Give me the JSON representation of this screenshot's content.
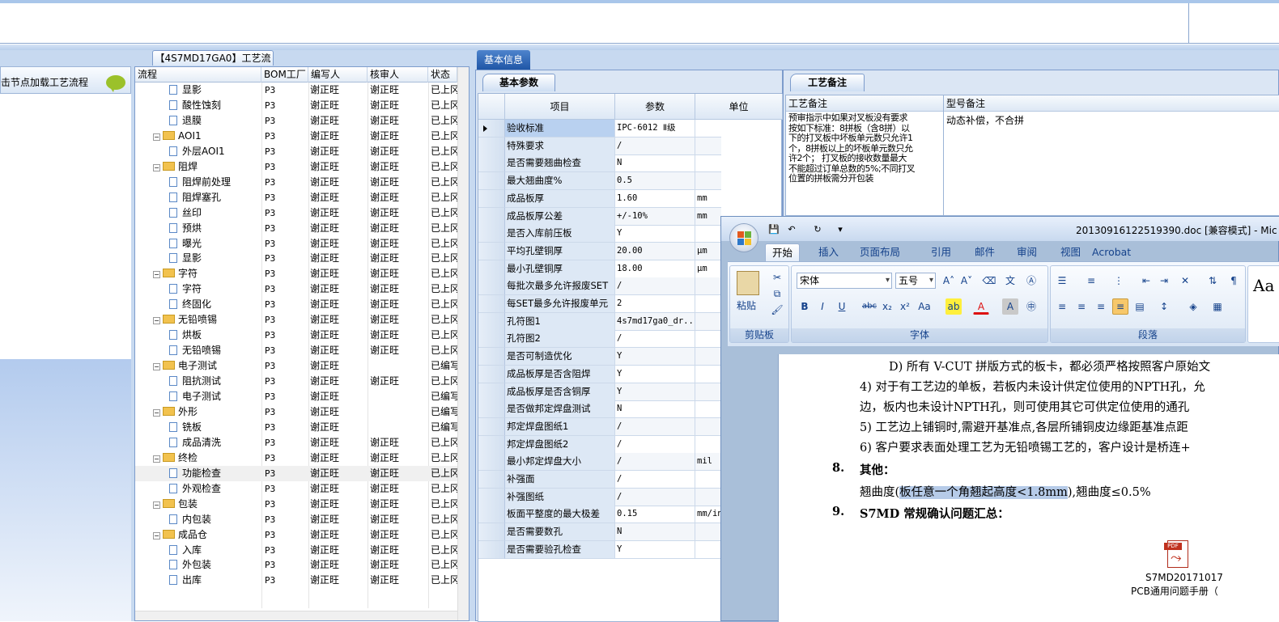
{
  "left_panel": {
    "hint": "击节点加载工艺流程"
  },
  "tree": {
    "tab_title": "【4S7MD17GA0】工艺流程",
    "columns": [
      "流程",
      "BOM工厂",
      "编写人",
      "核审人",
      "状态"
    ],
    "rows": [
      {
        "name": "显影",
        "kind": "doc",
        "bom": "P3",
        "writer": "谢正旺",
        "reviewer": "谢正旺",
        "status": "已上冈"
      },
      {
        "name": "酸性蚀刻",
        "kind": "doc",
        "bom": "P3",
        "writer": "谢正旺",
        "reviewer": "谢正旺",
        "status": "已上冈"
      },
      {
        "name": "退膜",
        "kind": "doc",
        "bom": "P3",
        "writer": "谢正旺",
        "reviewer": "谢正旺",
        "status": "已上冈"
      },
      {
        "name": "AOI1",
        "kind": "folder",
        "bom": "P3",
        "writer": "谢正旺",
        "reviewer": "谢正旺",
        "status": "已上冈"
      },
      {
        "name": "外层AOI1",
        "kind": "doc",
        "bom": "P3",
        "writer": "谢正旺",
        "reviewer": "谢正旺",
        "status": "已上冈"
      },
      {
        "name": "阻焊",
        "kind": "folder",
        "bom": "P3",
        "writer": "谢正旺",
        "reviewer": "谢正旺",
        "status": "已上冈"
      },
      {
        "name": "阻焊前处理",
        "kind": "doc",
        "bom": "P3",
        "writer": "谢正旺",
        "reviewer": "谢正旺",
        "status": "已上冈"
      },
      {
        "name": "阻焊塞孔",
        "kind": "doc",
        "bom": "P3",
        "writer": "谢正旺",
        "reviewer": "谢正旺",
        "status": "已上冈"
      },
      {
        "name": "丝印",
        "kind": "doc",
        "bom": "P3",
        "writer": "谢正旺",
        "reviewer": "谢正旺",
        "status": "已上冈"
      },
      {
        "name": "预烘",
        "kind": "doc",
        "bom": "P3",
        "writer": "谢正旺",
        "reviewer": "谢正旺",
        "status": "已上冈"
      },
      {
        "name": "曝光",
        "kind": "doc",
        "bom": "P3",
        "writer": "谢正旺",
        "reviewer": "谢正旺",
        "status": "已上冈"
      },
      {
        "name": "显影",
        "kind": "doc",
        "bom": "P3",
        "writer": "谢正旺",
        "reviewer": "谢正旺",
        "status": "已上冈"
      },
      {
        "name": "字符",
        "kind": "folder",
        "bom": "P3",
        "writer": "谢正旺",
        "reviewer": "谢正旺",
        "status": "已上冈"
      },
      {
        "name": "字符",
        "kind": "doc",
        "bom": "P3",
        "writer": "谢正旺",
        "reviewer": "谢正旺",
        "status": "已上冈"
      },
      {
        "name": "终固化",
        "kind": "doc",
        "bom": "P3",
        "writer": "谢正旺",
        "reviewer": "谢正旺",
        "status": "已上冈"
      },
      {
        "name": "无铅喷锡",
        "kind": "folder",
        "bom": "P3",
        "writer": "谢正旺",
        "reviewer": "谢正旺",
        "status": "已上冈"
      },
      {
        "name": "烘板",
        "kind": "doc",
        "bom": "P3",
        "writer": "谢正旺",
        "reviewer": "谢正旺",
        "status": "已上冈"
      },
      {
        "name": "无铅喷锡",
        "kind": "doc",
        "bom": "P3",
        "writer": "谢正旺",
        "reviewer": "谢正旺",
        "status": "已上冈"
      },
      {
        "name": "电子测试",
        "kind": "folder",
        "bom": "P3",
        "writer": "谢正旺",
        "reviewer": "",
        "status": "已编写"
      },
      {
        "name": "阻抗测试",
        "kind": "doc",
        "bom": "P3",
        "writer": "谢正旺",
        "reviewer": "谢正旺",
        "status": "已上冈"
      },
      {
        "name": "电子测试",
        "kind": "doc",
        "bom": "P3",
        "writer": "谢正旺",
        "reviewer": "",
        "status": "已编写"
      },
      {
        "name": "外形",
        "kind": "folder",
        "bom": "P3",
        "writer": "谢正旺",
        "reviewer": "",
        "status": "已编写"
      },
      {
        "name": "铣板",
        "kind": "doc",
        "bom": "P3",
        "writer": "谢正旺",
        "reviewer": "",
        "status": "已编写"
      },
      {
        "name": "成品清洗",
        "kind": "doc",
        "bom": "P3",
        "writer": "谢正旺",
        "reviewer": "谢正旺",
        "status": "已上冈"
      },
      {
        "name": "终检",
        "kind": "folder",
        "bom": "P3",
        "writer": "谢正旺",
        "reviewer": "谢正旺",
        "status": "已上冈"
      },
      {
        "name": "功能检查",
        "kind": "doc",
        "bom": "P3",
        "writer": "谢正旺",
        "reviewer": "谢正旺",
        "status": "已上冈",
        "selected": true
      },
      {
        "name": "外观检查",
        "kind": "doc",
        "bom": "P3",
        "writer": "谢正旺",
        "reviewer": "谢正旺",
        "status": "已上冈"
      },
      {
        "name": "包装",
        "kind": "folder",
        "bom": "P3",
        "writer": "谢正旺",
        "reviewer": "谢正旺",
        "status": "已上冈"
      },
      {
        "name": "内包装",
        "kind": "doc",
        "bom": "P3",
        "writer": "谢正旺",
        "reviewer": "谢正旺",
        "status": "已上冈"
      },
      {
        "name": "成品仓",
        "kind": "folder",
        "bom": "P3",
        "writer": "谢正旺",
        "reviewer": "谢正旺",
        "status": "已上冈"
      },
      {
        "name": "入库",
        "kind": "doc",
        "bom": "P3",
        "writer": "谢正旺",
        "reviewer": "谢正旺",
        "status": "已上冈"
      },
      {
        "name": "外包装",
        "kind": "doc",
        "bom": "P3",
        "writer": "谢正旺",
        "reviewer": "谢正旺",
        "status": "已上冈"
      },
      {
        "name": "出库",
        "kind": "doc",
        "bom": "P3",
        "writer": "谢正旺",
        "reviewer": "谢正旺",
        "status": "已上冈"
      }
    ]
  },
  "basic_info": {
    "tab": "基本信息",
    "subtab": "基本参数",
    "columns": [
      "项目",
      "参数",
      "单位"
    ],
    "rows": [
      {
        "item": "验收标准",
        "value": "IPC-6012 Ⅱ级",
        "unit": ""
      },
      {
        "item": "特殊要求",
        "value": "/",
        "unit": ""
      },
      {
        "item": "是否需要翘曲检查",
        "value": "N",
        "unit": ""
      },
      {
        "item": "最大翘曲度%",
        "value": "0.5",
        "unit": ""
      },
      {
        "item": "成品板厚",
        "value": "1.60",
        "unit": "mm"
      },
      {
        "item": "成品板厚公差",
        "value": "+/-10%",
        "unit": "mm"
      },
      {
        "item": "是否入库前压板",
        "value": "Y",
        "unit": ""
      },
      {
        "item": "平均孔壁铜厚",
        "value": "20.00",
        "unit": "μm"
      },
      {
        "item": "最小孔壁铜厚",
        "value": "18.00",
        "unit": "μm"
      },
      {
        "item": "每批次最多允许报废SET",
        "value": "/",
        "unit": ""
      },
      {
        "item": "每SET最多允许报废单元",
        "value": "2",
        "unit": ""
      },
      {
        "item": "孔符图1",
        "value": "4s7md17ga0_dr...",
        "unit": ""
      },
      {
        "item": "孔符图2",
        "value": "/",
        "unit": ""
      },
      {
        "item": "是否可制造优化",
        "value": "Y",
        "unit": ""
      },
      {
        "item": "成品板厚是否含阻焊",
        "value": "Y",
        "unit": ""
      },
      {
        "item": "成品板厚是否含铜厚",
        "value": "Y",
        "unit": ""
      },
      {
        "item": "是否做邦定焊盘测试",
        "value": "N",
        "unit": ""
      },
      {
        "item": "邦定焊盘图纸1",
        "value": "/",
        "unit": ""
      },
      {
        "item": "邦定焊盘图纸2",
        "value": "/",
        "unit": ""
      },
      {
        "item": "最小邦定焊盘大小",
        "value": "/",
        "unit": "mil"
      },
      {
        "item": "补强面",
        "value": "/",
        "unit": ""
      },
      {
        "item": "补强图纸",
        "value": "/",
        "unit": ""
      },
      {
        "item": "板面平整度的最大极差",
        "value": "0.15",
        "unit": "mm/in"
      },
      {
        "item": "是否需要数孔",
        "value": "N",
        "unit": ""
      },
      {
        "item": "是否需要验孔检查",
        "value": "Y",
        "unit": ""
      }
    ]
  },
  "notes": {
    "tab": "工艺备注",
    "process_header": "工艺备注",
    "model_header": "型号备注",
    "process_lines": [
      "预审指示中如果对叉板没有要求",
      "按如下标准：8拼板（含8拼）以",
      "下的打叉板中坏板单元数只允许1",
      "个，8拼板以上的坏板单元数只允",
      "许2个；  打叉板的接收数量最大",
      "不能超过订单总数的5%;不同打叉",
      "位置的拼板需分开包装"
    ],
    "model_text": "动态补偿，不合拼"
  },
  "word": {
    "title": "20130916122519390.doc [兼容模式] - Mic",
    "tabs": [
      "开始",
      "插入",
      "页面布局",
      "引用",
      "邮件",
      "审阅",
      "视图",
      "Acrobat"
    ],
    "font_name": "宋体",
    "font_size": "五号",
    "paste_label": "粘贴",
    "group_clipboard": "剪贴板",
    "group_font": "字体",
    "group_paragraph": "段落",
    "styles_preview": "Aa",
    "doc_lines": [
      "D) 所有 V-CUT 拼版方式的板卡，都必须严格按照客户原始文",
      "4)  对于有工艺边的单板，若板内未设计供定位使用的NPTH孔，允",
      "边，板内也未设计NPTH孔，则可使用其它可供定位使用的通孔",
      "5)  工艺边上铺铜时,需避开基准点,各层所铺铜皮边缘距基准点距",
      "6)  客户要求表面处理工艺为无铅喷锡工艺的，客户设计是桥连+"
    ],
    "item8_num": "8.",
    "item8_title": "其他：",
    "warp_pre": "翘曲度(",
    "warp_hl": "板任意一个角翘起高度<1.8mm",
    "warp_post": "),翘曲度≤0.5%",
    "item9_num": "9.",
    "item9_title": "S7MD 常规确认问题汇总：",
    "pdf_badge": "PDF",
    "pdf_caption1": "S7MD20171017",
    "pdf_caption2": "PCB通用问题手册（"
  }
}
